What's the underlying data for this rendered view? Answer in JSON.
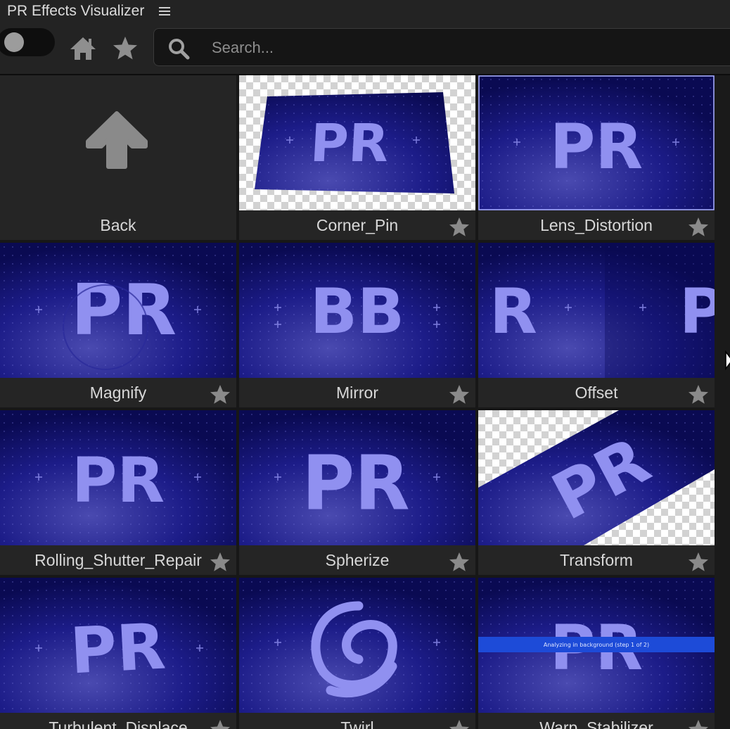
{
  "app": {
    "title": "PR Effects Visualizer"
  },
  "toolbar": {
    "search_placeholder": "Search..."
  },
  "grid": {
    "back_label": "Back",
    "items": [
      {
        "label": "Corner_Pin",
        "thumb": "corner-pin",
        "favorite_icon": "star-icon"
      },
      {
        "label": "Lens_Distortion",
        "thumb": "lens",
        "favorite_icon": "star-icon"
      },
      {
        "label": "Magnify",
        "thumb": "magnify",
        "favorite_icon": "star-icon"
      },
      {
        "label": "Mirror",
        "thumb": "mirror",
        "thumb_text": "BB",
        "favorite_icon": "star-icon"
      },
      {
        "label": "Offset",
        "thumb": "offset",
        "favorite_icon": "star-icon"
      },
      {
        "label": "Rolling_Shutter_Repair",
        "thumb": "plain",
        "favorite_icon": "star-icon"
      },
      {
        "label": "Spherize",
        "thumb": "spherize",
        "favorite_icon": "star-icon"
      },
      {
        "label": "Transform",
        "thumb": "transform",
        "favorite_icon": "star-icon"
      },
      {
        "label": "Turbulent_Displace",
        "thumb": "turbulent",
        "favorite_icon": "star-icon"
      },
      {
        "label": "Twirl",
        "thumb": "twirl",
        "favorite_icon": "star-icon"
      },
      {
        "label": "Warp_Stabilizer",
        "thumb": "warp",
        "thumb_text": "Analyzing in background (step 1 of 2)",
        "favorite_icon": "star-icon"
      }
    ]
  },
  "thumbnail_text": "PR",
  "colors": {
    "background": "#1e1e1e",
    "tile": "#252525",
    "thumb_dark": "#0a0a52",
    "thumb_glow": "#4a4ab0",
    "letter": "#9090f0",
    "icon_gray": "#8a8a8a"
  }
}
